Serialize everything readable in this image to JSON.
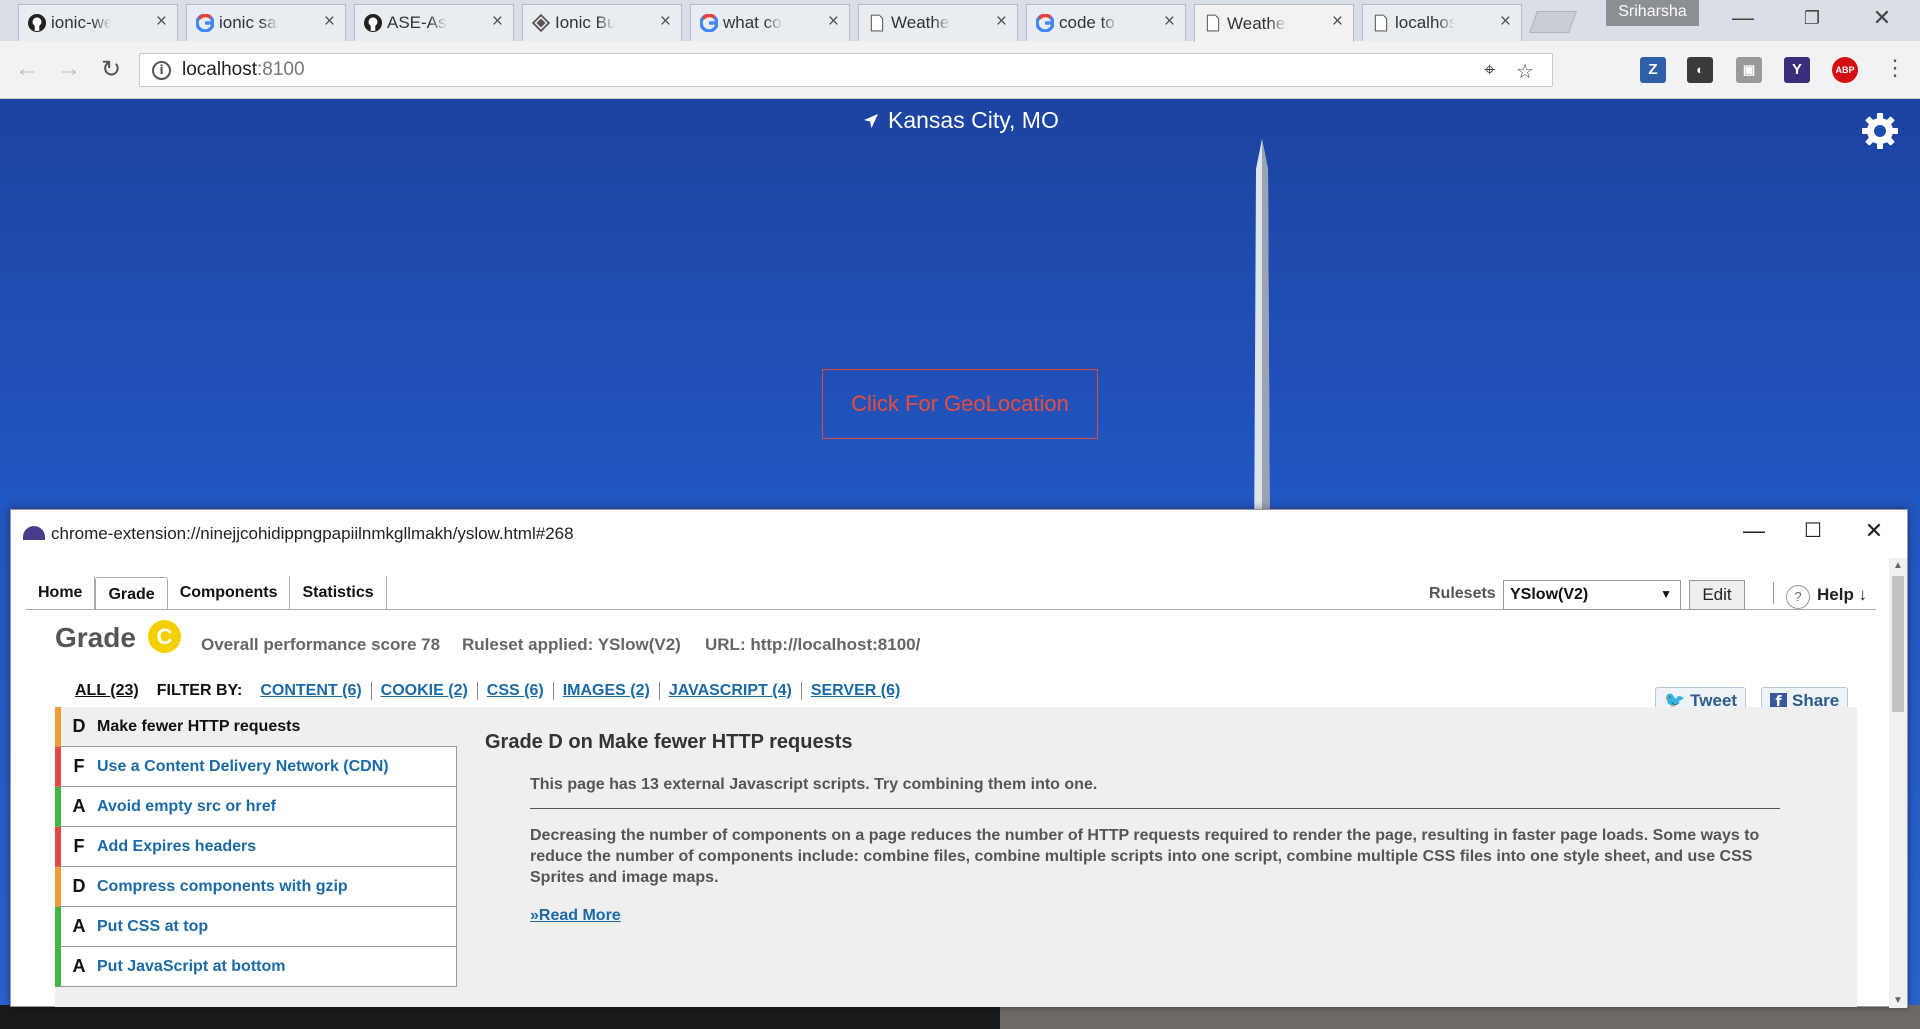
{
  "browser": {
    "tabs": [
      {
        "label": "ionic-wea",
        "icon": "github-icon",
        "active": false
      },
      {
        "label": "ionic sam",
        "icon": "google-icon",
        "active": false
      },
      {
        "label": "ASE-Assig",
        "icon": "github-icon",
        "active": false
      },
      {
        "label": "Ionic Butt",
        "icon": "ionic-icon",
        "active": false
      },
      {
        "label": "what corc",
        "icon": "google-icon",
        "active": false
      },
      {
        "label": "Weather",
        "icon": "page-icon",
        "active": false
      },
      {
        "label": "code to n",
        "icon": "google-icon",
        "active": false
      },
      {
        "label": "Weather",
        "icon": "page-icon",
        "active": true
      },
      {
        "label": "localhost:",
        "icon": "page-icon",
        "active": false
      }
    ],
    "profile_name": "Sriharsha",
    "url_host": "localhost",
    "url_port": ":8100",
    "extensions": [
      {
        "name": "zotero-icon",
        "glyph": "Z",
        "color": "#2f5fa8"
      },
      {
        "name": "lightbulb-icon",
        "glyph": "💡",
        "color": "#3a3a3a"
      },
      {
        "name": "camera-icon",
        "glyph": "📷",
        "color": "#9a9a9a"
      },
      {
        "name": "yslow-icon",
        "glyph": "Y",
        "color": "#3c2d7a"
      },
      {
        "name": "adblock-icon",
        "glyph": "ABP",
        "color": "#d40d12"
      }
    ]
  },
  "app": {
    "location": "Kansas City, MO",
    "geo_button": "Click For GeoLocation"
  },
  "yslow": {
    "window_title": "chrome-extension://ninejjcohidippngpapiilnmkgllmakh/yslow.html#268",
    "tabs": [
      "Home",
      "Grade",
      "Components",
      "Statistics"
    ],
    "active_tab": "Grade",
    "rulesets_label": "Rulesets",
    "ruleset_value": "YSlow(V2)",
    "edit_label": "Edit",
    "help_label": "Help ↓",
    "grade_label": "Grade",
    "grade_letter": "C",
    "score_text": "Overall performance score 78",
    "ruleset_text": "Ruleset applied: YSlow(V2)",
    "url_text": "URL: http://localhost:8100/",
    "filter_all": "ALL (23)",
    "filter_by": "FILTER BY:",
    "filters": [
      "CONTENT (6)",
      "COOKIE (2)",
      "CSS (6)",
      "IMAGES (2)",
      "JAVASCRIPT (4)",
      "SERVER (6)"
    ],
    "tweet_label": "Tweet",
    "share_label": "Share",
    "rules": [
      {
        "grade": "D",
        "name": "Make fewer HTTP requests",
        "selected": true
      },
      {
        "grade": "F",
        "name": "Use a Content Delivery Network (CDN)",
        "selected": false
      },
      {
        "grade": "A",
        "name": "Avoid empty src or href",
        "selected": false
      },
      {
        "grade": "F",
        "name": "Add Expires headers",
        "selected": false
      },
      {
        "grade": "D",
        "name": "Compress components with gzip",
        "selected": false
      },
      {
        "grade": "A",
        "name": "Put CSS at top",
        "selected": false
      },
      {
        "grade": "A",
        "name": "Put JavaScript at bottom",
        "selected": false
      }
    ],
    "detail": {
      "title": "Grade D on Make fewer HTTP requests",
      "summary": "This page has 13 external Javascript scripts. Try combining them into one.",
      "description": "Decreasing the number of components on a page reduces the number of HTTP requests required to render the page, resulting in faster page loads. Some ways to reduce the number of components include: combine files, combine multiple scripts into one script, combine multiple CSS files into one style sheet, and use CSS Sprites and image maps.",
      "read_more": "»Read More"
    }
  }
}
